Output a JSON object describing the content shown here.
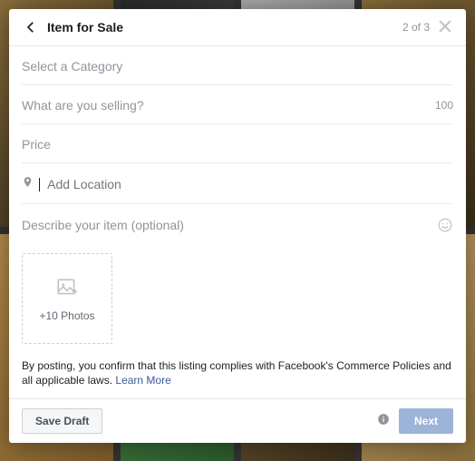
{
  "header": {
    "title": "Item for Sale",
    "step": "2 of 3"
  },
  "fields": {
    "category": {
      "placeholder": "Select a Category"
    },
    "title": {
      "placeholder": "What are you selling?",
      "charLimit": "100"
    },
    "price": {
      "placeholder": "Price"
    },
    "location": {
      "placeholder": "Add Location"
    },
    "description": {
      "placeholder": "Describe your item (optional)"
    }
  },
  "photos": {
    "label": "+10 Photos"
  },
  "disclosure": {
    "text": "By posting, you confirm that this listing complies with Facebook's Commerce Policies and all applicable laws. ",
    "link": "Learn More"
  },
  "footer": {
    "saveDraft": "Save Draft",
    "next": "Next"
  }
}
